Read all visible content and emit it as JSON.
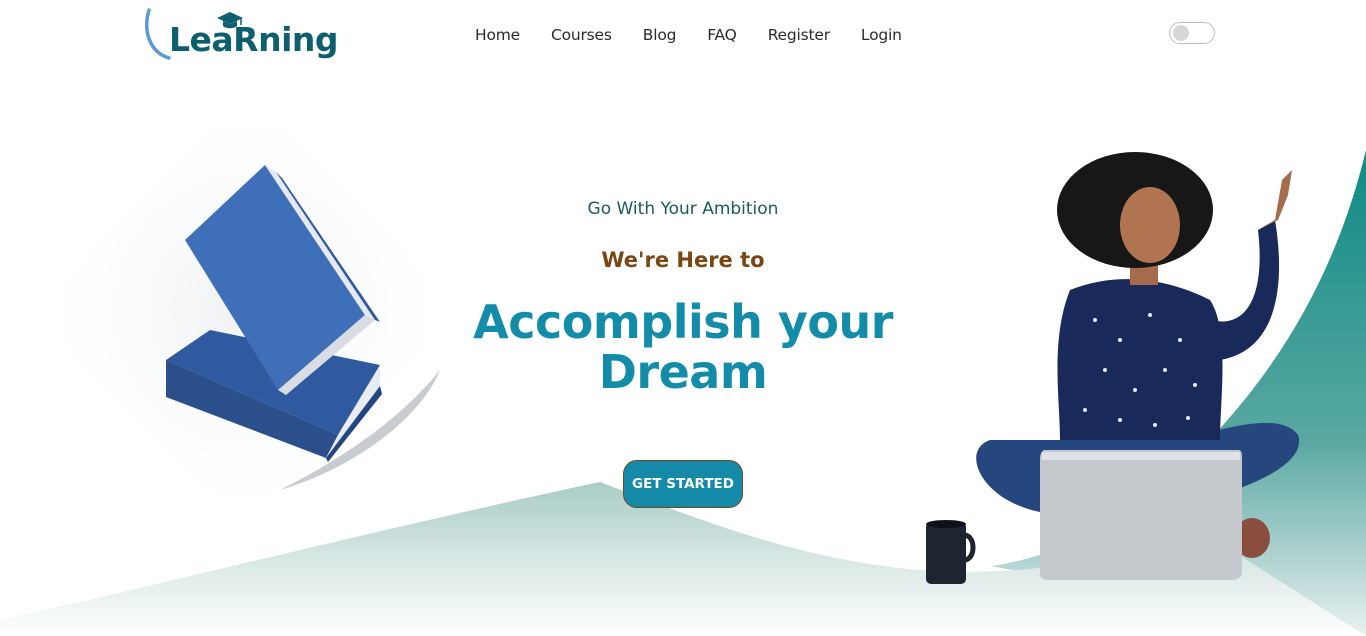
{
  "brand": {
    "logo_text": "LeaRning"
  },
  "nav": {
    "items": [
      "Home",
      "Courses",
      "Blog",
      "FAQ",
      "Register",
      "Login"
    ]
  },
  "theme_toggle": {
    "state": "off"
  },
  "hero": {
    "tagline": "Go With Your Ambition",
    "subtitle": "We're Here to",
    "title_line1": "Accomplish your",
    "title_line2": "Dream",
    "cta_label": "GET STARTED"
  },
  "colors": {
    "brand_dark": "#0e5f6e",
    "accent": "#138caa",
    "subtitle_brown": "#7a4713",
    "teal_wave": "#0f8a83"
  },
  "icons": [
    "graduation-cap-icon",
    "toggle-switch-icon"
  ]
}
